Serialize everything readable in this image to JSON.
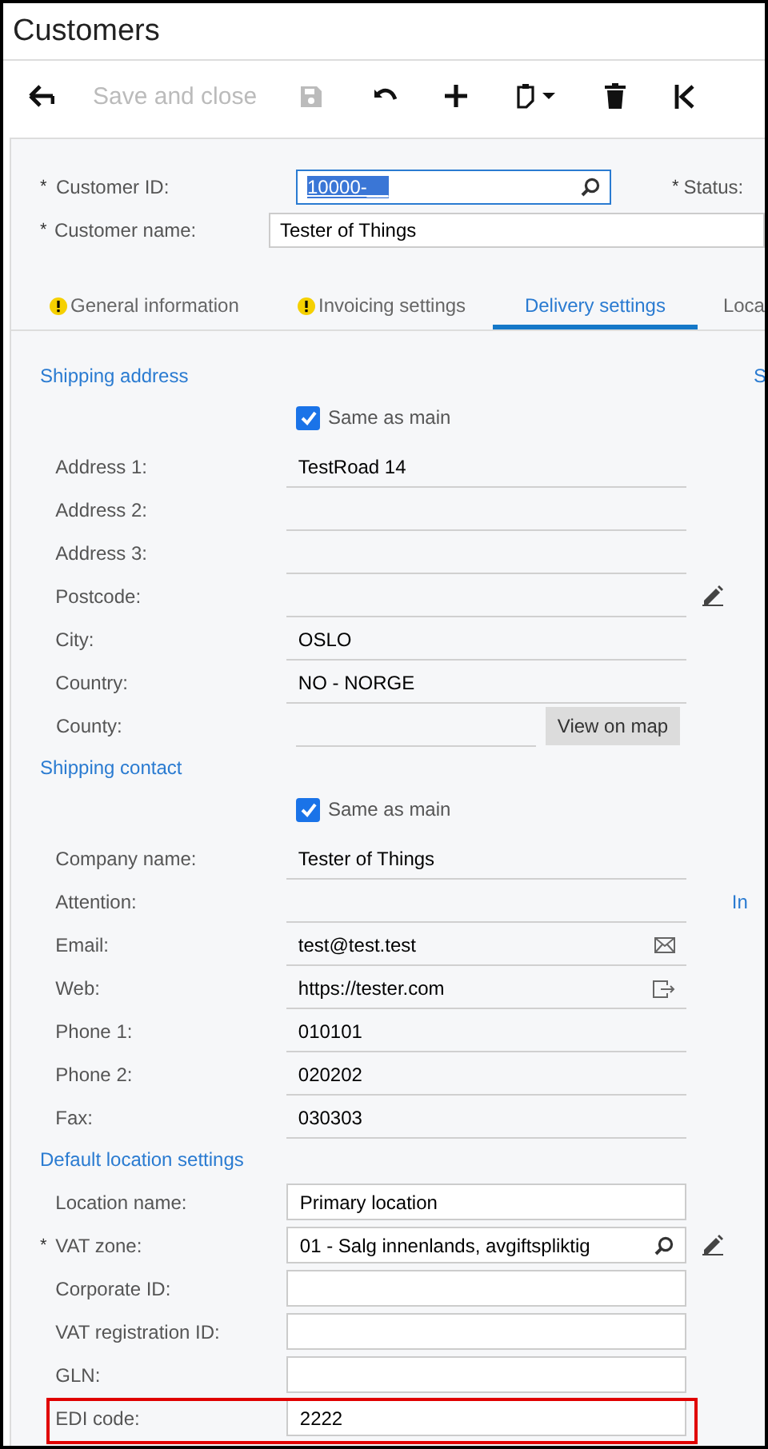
{
  "window": {
    "title": "Customers"
  },
  "toolbar": [
    {
      "kind": "back",
      "disabled": false
    },
    {
      "kind": "text",
      "label": "Save and close",
      "disabled": true
    },
    {
      "kind": "save",
      "disabled": true
    },
    {
      "kind": "undo",
      "disabled": false
    },
    {
      "kind": "add",
      "disabled": false
    },
    {
      "kind": "paste",
      "disabled": false
    },
    {
      "kind": "delete",
      "disabled": false
    },
    {
      "kind": "first",
      "disabled": false
    }
  ],
  "header_fields": [
    {
      "required_mark": "*",
      "label": "Customer ID:",
      "value": "10000-__",
      "focused": true,
      "kind": "lookup"
    },
    {
      "required_mark": "*",
      "label": "Customer name:",
      "value": "Tester of Things",
      "focused": false,
      "kind": "text"
    }
  ],
  "status": {
    "required_mark": "*",
    "label": "Status:"
  },
  "tabs": [
    {
      "label": "General information",
      "warning": true,
      "selected": false
    },
    {
      "label": "Invoicing settings",
      "warning": true,
      "selected": false
    },
    {
      "label": "Delivery settings",
      "warning": false,
      "selected": true
    },
    {
      "label": "Loca",
      "warning": false,
      "selected": false
    }
  ],
  "sections": [
    {
      "title": "Shipping address",
      "side_text": "S",
      "same_as_main": {
        "label": "Same as main",
        "checked": true
      },
      "fields": [
        {
          "label": "Address 1:",
          "value": "TestRoad 14",
          "kind": "plain"
        },
        {
          "label": "Address 2:",
          "kind": "plain"
        },
        {
          "label": "Address 3:",
          "kind": "plain"
        },
        {
          "label": "Postcode:",
          "kind": "postcode"
        },
        {
          "label": "City:",
          "value": "OSLO",
          "kind": "plain"
        },
        {
          "label": "Country:",
          "value": "NO - NORGE",
          "kind": "plain"
        },
        {
          "label": "County:",
          "kind": "county",
          "button": "View on map"
        }
      ]
    },
    {
      "title": "Shipping contact",
      "same_as_main": {
        "label": "Same as main",
        "checked": true
      },
      "fields": [
        {
          "label": "Company name:",
          "value": "Tester of Things",
          "kind": "plain"
        },
        {
          "label": "Attention:",
          "kind": "plain",
          "side_text": "In"
        },
        {
          "label": "Email:",
          "value": "test@test.test",
          "kind": "email"
        },
        {
          "label": "Web:",
          "value": "https://tester.com",
          "kind": "web"
        },
        {
          "label": "Phone 1:",
          "value": "010101",
          "kind": "plain"
        },
        {
          "label": "Phone 2:",
          "value": "020202",
          "kind": "plain"
        },
        {
          "label": "Fax:",
          "value": "030303",
          "kind": "plain"
        }
      ]
    },
    {
      "title": "Default location settings",
      "fields": [
        {
          "label": "Location name:",
          "value": "Primary location",
          "kind": "boxed"
        },
        {
          "required_mark": "*",
          "label": "VAT zone:",
          "value": "01 - Salg innenlands, avgiftspliktig",
          "kind": "vatzone"
        },
        {
          "label": "Corporate ID:",
          "kind": "boxed"
        },
        {
          "label": "VAT registration ID:",
          "kind": "boxed"
        },
        {
          "label": "GLN:",
          "kind": "boxed"
        },
        {
          "label": "EDI code:",
          "value": "2222",
          "kind": "boxed",
          "highlighted": true
        }
      ]
    }
  ]
}
